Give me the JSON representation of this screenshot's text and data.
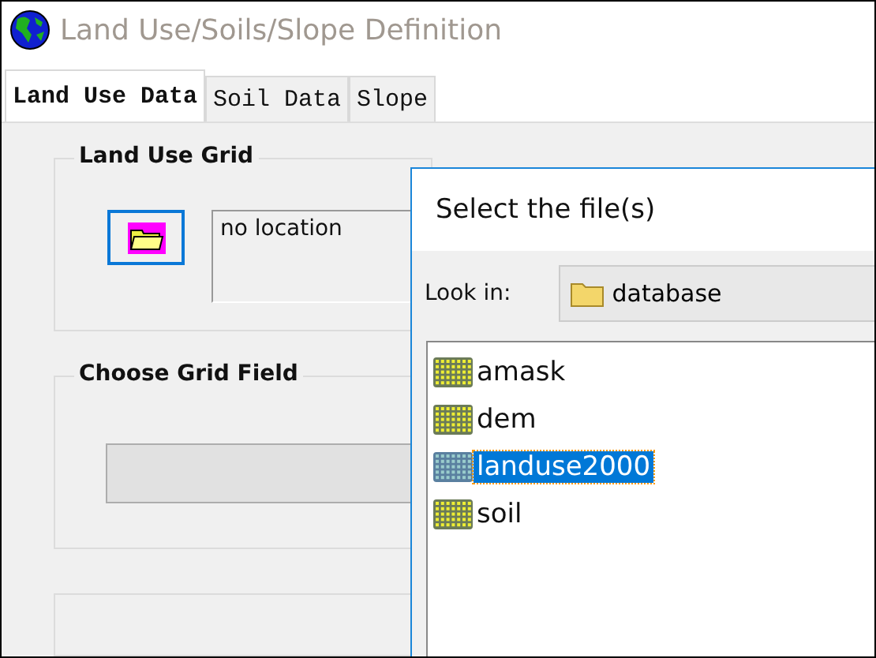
{
  "window": {
    "title": "Land Use/Soils/Slope Definition"
  },
  "tabs": [
    {
      "label": "Land Use Data",
      "selected": true
    },
    {
      "label": "Soil Data",
      "selected": false
    },
    {
      "label": "Slope",
      "selected": false
    }
  ],
  "land_use_grid": {
    "title": "Land Use Grid",
    "location": "no location"
  },
  "choose_grid_field": {
    "title": "Choose Grid Field"
  },
  "dialog": {
    "title": "Select the file(s)",
    "look_in_label": "Look in:",
    "look_in_value": "database",
    "files": [
      {
        "name": "amask",
        "selected": false
      },
      {
        "name": "dem",
        "selected": false
      },
      {
        "name": "landuse2000",
        "selected": true
      },
      {
        "name": "soil",
        "selected": false
      }
    ]
  }
}
